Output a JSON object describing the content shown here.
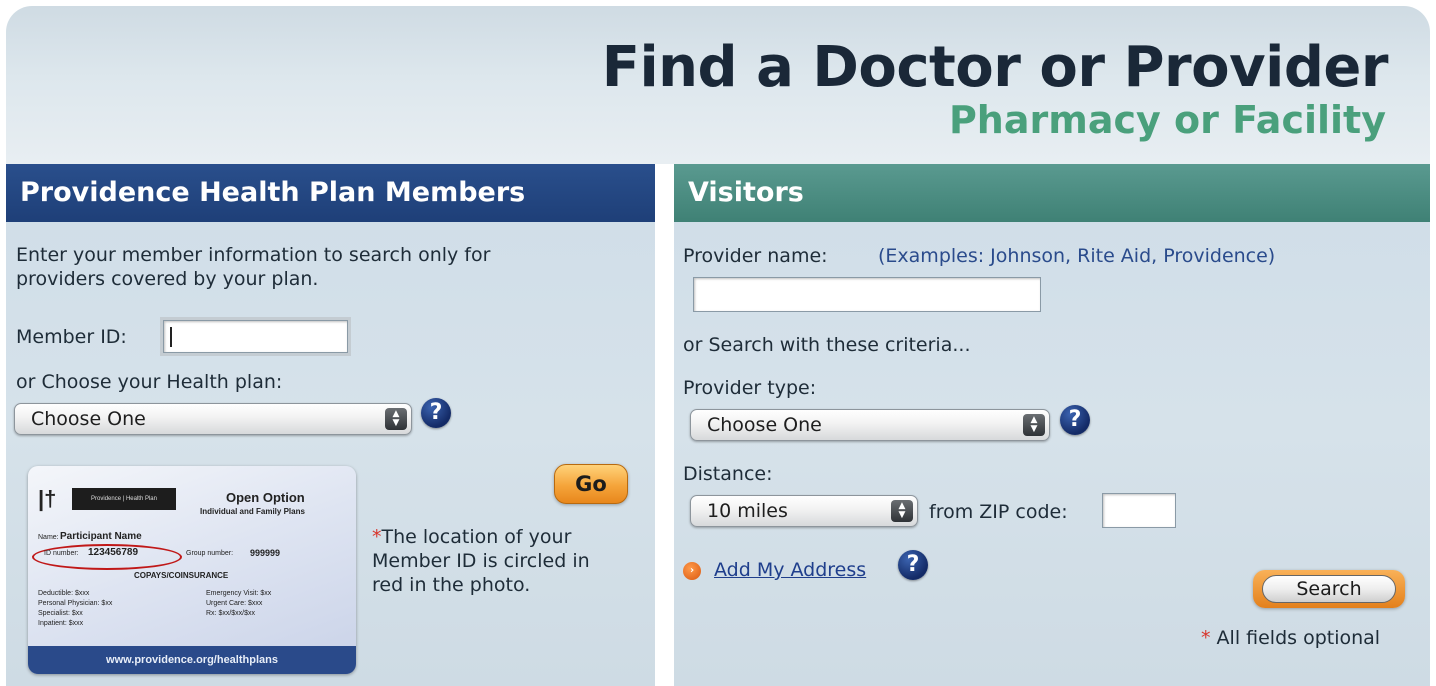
{
  "header": {
    "title": "Find a Doctor or Provider",
    "subtitle": "Pharmacy or Facility"
  },
  "members": {
    "heading": "Providence Health Plan Members",
    "intro_line1": "Enter your member information to search only for",
    "intro_line2": "providers covered by your plan.",
    "member_id_label": "Member ID:",
    "member_id_value": "",
    "plan_label": "or Choose your Health plan:",
    "plan_select": "Choose One",
    "go_label": "Go",
    "note_line1": "The location of your",
    "note_line2": "Member ID is circled in",
    "note_line3": "red in the photo.",
    "card": {
      "logo_text": "Providence | Health Plan",
      "plan_name": "Open Option",
      "plan_sub": "Individual and Family Plans",
      "name_label": "Name:",
      "name_value": "Participant Name",
      "id_label": "ID number:",
      "id_value": "123456789",
      "group_label": "Group number:",
      "group_value": "999999",
      "copays_heading": "COPAYS/COINSURANCE",
      "left_lines": [
        "Deductible: $xxx",
        "Personal Physician: $xx",
        "Specialist: $xx",
        "Inpatient: $xxx"
      ],
      "right_lines": [
        "Emergency Visit: $xx",
        "Urgent Care: $xxx",
        "Rx: $xx/$xx/$xx"
      ],
      "website": "www.providence.org/healthplans"
    }
  },
  "visitors": {
    "heading": "Visitors",
    "provider_name_label": "Provider name:",
    "provider_examples": "(Examples: Johnson, Rite Aid, Providence)",
    "provider_name_value": "",
    "criteria_text": "or Search with these criteria...",
    "provider_type_label": "Provider type:",
    "provider_type_select": "Choose One",
    "distance_label": "Distance:",
    "distance_select": "10 miles",
    "zip_label": "from ZIP code:",
    "zip_value": "",
    "add_address": "Add My Address",
    "search_label": "Search",
    "optional_note": "All fields optional"
  },
  "colors": {
    "members_header": "#1e3f78",
    "visitors_header": "#3f8175",
    "subtitle_green": "#4aa07c",
    "button_orange": "#f5a43a",
    "asterisk_red": "#d8342b"
  }
}
